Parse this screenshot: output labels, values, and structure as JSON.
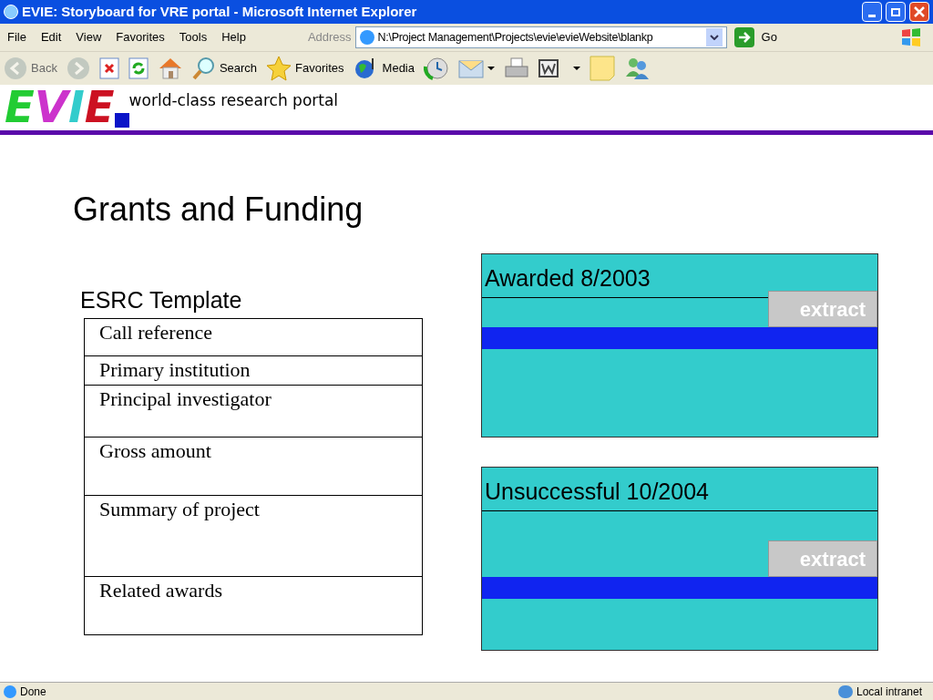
{
  "window": {
    "title": "EVIE: Storyboard for VRE portal - Microsoft Internet Explorer"
  },
  "menu_bar": [
    "File",
    "Edit",
    "View",
    "Favorites",
    "Tools",
    "Help"
  ],
  "address": {
    "label": "Address",
    "value": "N:\\Project Management\\Projects\\evie\\evieWebsite\\blankp",
    "go": "Go"
  },
  "toolbar": [
    {
      "kind": "back",
      "label": "Back",
      "disabled": true
    },
    {
      "kind": "forward",
      "disabled": true
    },
    {
      "kind": "stop",
      "disabled": false
    },
    {
      "kind": "refresh",
      "disabled": false
    },
    {
      "kind": "home",
      "disabled": false
    },
    {
      "kind": "search",
      "label": "Search",
      "disabled": false
    },
    {
      "kind": "favorites",
      "label": "Favorites",
      "disabled": false
    },
    {
      "kind": "media",
      "label": "Media",
      "disabled": false
    },
    {
      "kind": "history",
      "disabled": false
    },
    {
      "kind": "mail",
      "disabled": false
    },
    {
      "kind": "print",
      "disabled": false
    },
    {
      "kind": "edit",
      "disabled": false
    },
    {
      "kind": "note",
      "disabled": false
    },
    {
      "kind": "messenger",
      "disabled": false
    }
  ],
  "logo": {
    "letters": [
      {
        "char": "E",
        "color": "#22cc33"
      },
      {
        "char": "V",
        "color": "#cc33cc"
      },
      {
        "char": "I",
        "color": "#33cccc"
      },
      {
        "char": "E",
        "color": "#cc1122"
      }
    ],
    "tagline": "world-class research portal"
  },
  "heading": "Grants and Funding",
  "template": {
    "title": "ESRC Template",
    "fields": [
      "Call reference",
      "Primary institution",
      "Principal investigator",
      "Gross amount",
      "Summary of project",
      "Related awards"
    ]
  },
  "grants": [
    {
      "title": "Awarded 8/2003",
      "button": "extract"
    },
    {
      "title": "Unsuccessful 10/2004",
      "button": "extract"
    }
  ],
  "status_bar": {
    "text": "Done",
    "zone": "Local intranet"
  }
}
